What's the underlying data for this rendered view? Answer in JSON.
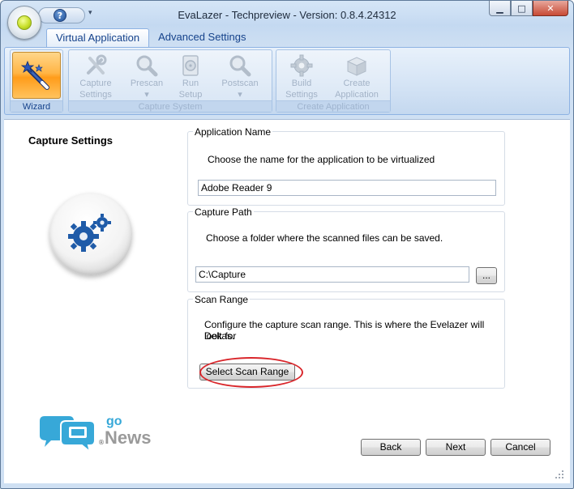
{
  "window": {
    "title": "EvaLazer - Techpreview - Version: 0.8.4.24312",
    "minimize_glyph": "▁",
    "maximize_glyph": "□",
    "close_glyph": "✕",
    "help_glyph": "?",
    "qat_dropdown_glyph": "▾"
  },
  "tabs": [
    {
      "label": "Virtual Application",
      "active": true
    },
    {
      "label": "Advanced Settings",
      "active": false
    }
  ],
  "ribbon": {
    "groups": [
      {
        "label": "Wizard",
        "buttons": [
          {
            "label": "",
            "icon": "wizard-wand-icon",
            "enabled": true
          }
        ]
      },
      {
        "label": "Capture System",
        "buttons": [
          {
            "label": "Capture Settings",
            "line1": "Capture",
            "line2": "Settings",
            "icon": "tools-icon",
            "enabled": false
          },
          {
            "label": "Prescan",
            "line1": "Prescan",
            "line2": "▾",
            "icon": "magnifier-icon",
            "enabled": false
          },
          {
            "label": "Run Setup",
            "line1": "Run",
            "line2": "Setup",
            "icon": "setup-disc-icon",
            "enabled": false
          },
          {
            "label": "Postscan",
            "line1": "Postscan",
            "line2": "▾",
            "icon": "magnifier-icon",
            "enabled": false
          }
        ]
      },
      {
        "label": "Create Application",
        "buttons": [
          {
            "label": "Build Settings",
            "line1": "Build",
            "line2": "Settings",
            "icon": "gear-icon",
            "enabled": false
          },
          {
            "label": "Create Application",
            "line1": "Create",
            "line2": "Application",
            "icon": "package-box-icon",
            "enabled": false
          }
        ]
      }
    ]
  },
  "page": {
    "heading": "Capture Settings",
    "app_name": {
      "legend": "Application Name",
      "description": "Choose the name for the application to be virtualized",
      "value": "Adobe Reader 9"
    },
    "capture_path": {
      "legend": "Capture Path",
      "description": "Choose a folder where the scanned files can be saved.",
      "value": "C:\\Capture",
      "browse_label": "..."
    },
    "scan_range": {
      "legend": "Scan Range",
      "description_line1": "Configure the capture scan range. This is where the Evelazer will look for",
      "description_line2": "Deltas.",
      "button_label": "Select Scan Range"
    }
  },
  "footer": {
    "back_label": "Back",
    "next_label": "Next",
    "cancel_label": "Cancel"
  },
  "watermark": {
    "go": "go",
    "news": "News",
    "reg": "®"
  },
  "colors": {
    "ribbon_tab_text": "#15428b",
    "wizard_active": "#ffb545",
    "highlight_ring": "#d9262b",
    "gear_blue": "#1f5ba8"
  }
}
